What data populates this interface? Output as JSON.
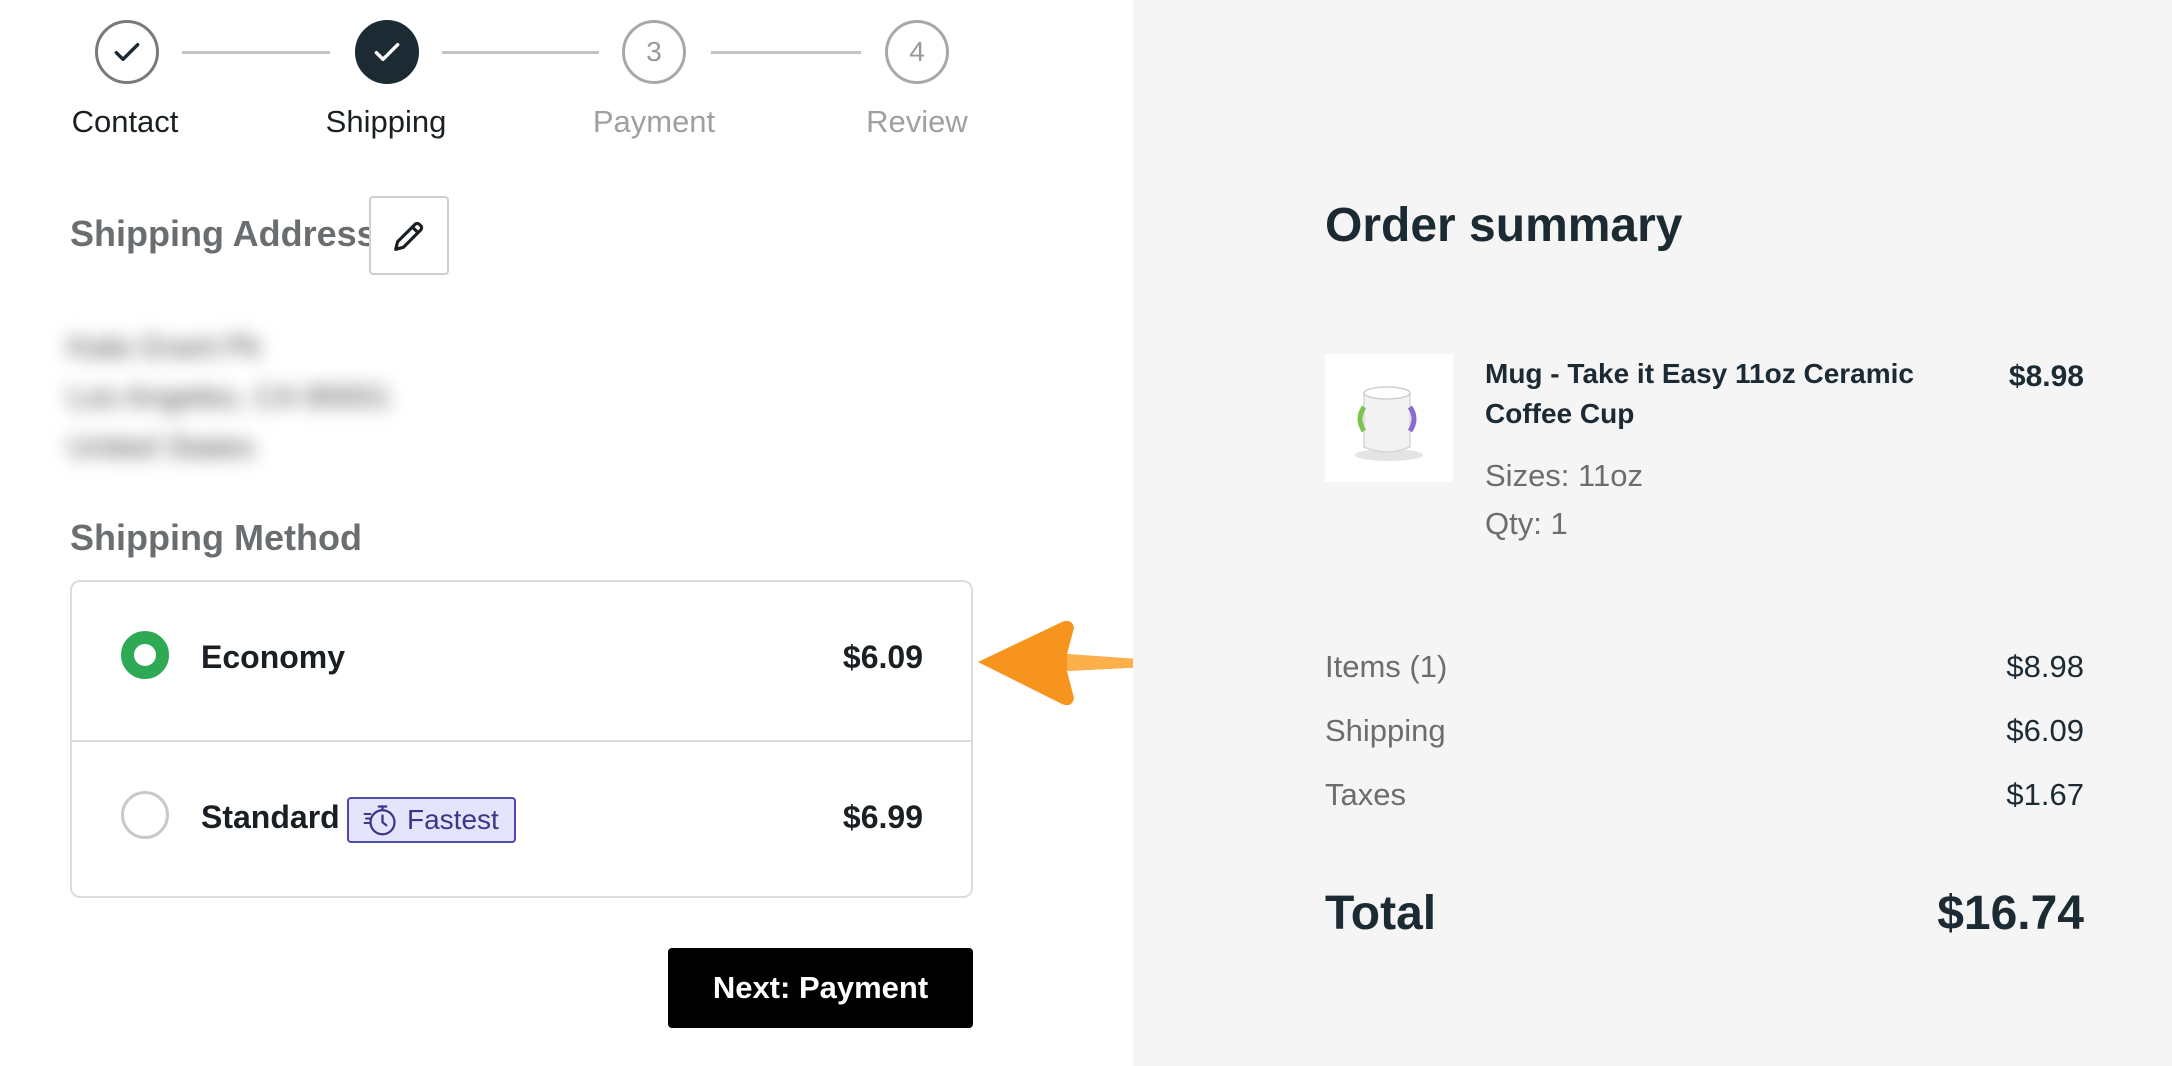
{
  "stepper": {
    "steps": [
      {
        "label": "Contact",
        "number": "",
        "state": "done"
      },
      {
        "label": "Shipping",
        "number": "",
        "state": "active"
      },
      {
        "label": "Payment",
        "number": "3",
        "state": "pending"
      },
      {
        "label": "Review",
        "number": "4",
        "state": "pending"
      }
    ]
  },
  "shipping_address": {
    "title": "Shipping Address",
    "edit_icon": "pencil-icon",
    "lines": [
      "Kala Grant Pk",
      "Los Angeles, CA 90001",
      "United States"
    ]
  },
  "shipping_method": {
    "title": "Shipping Method",
    "options": [
      {
        "name": "Economy",
        "price": "$6.09",
        "selected": true
      },
      {
        "name": "Standard",
        "price": "$6.99",
        "selected": false,
        "badge": "Fastest",
        "badge_icon": "stopwatch-icon"
      }
    ]
  },
  "next_button": {
    "label": "Next: Payment"
  },
  "annotation": {
    "icon": "arrow-left-icon",
    "color": "#f7941d"
  },
  "order_summary": {
    "title": "Order summary",
    "item": {
      "name": "Mug - Take it Easy 11oz Ceramic Coffee Cup",
      "price": "$8.98",
      "size": "Sizes: 11oz",
      "qty": "Qty: 1"
    },
    "rows": [
      {
        "label": "Items (1)",
        "value": "$8.98"
      },
      {
        "label": "Shipping",
        "value": "$6.09"
      },
      {
        "label": "Taxes",
        "value": "$1.67"
      }
    ],
    "total": {
      "label": "Total",
      "value": "$16.74"
    }
  },
  "colors": {
    "selected_radio": "#2eaa55",
    "active_step": "#1c2a33",
    "badge_bg": "#e6e4fa",
    "badge_border": "#4f4aa8",
    "summary_bg": "#f5f5f5"
  }
}
